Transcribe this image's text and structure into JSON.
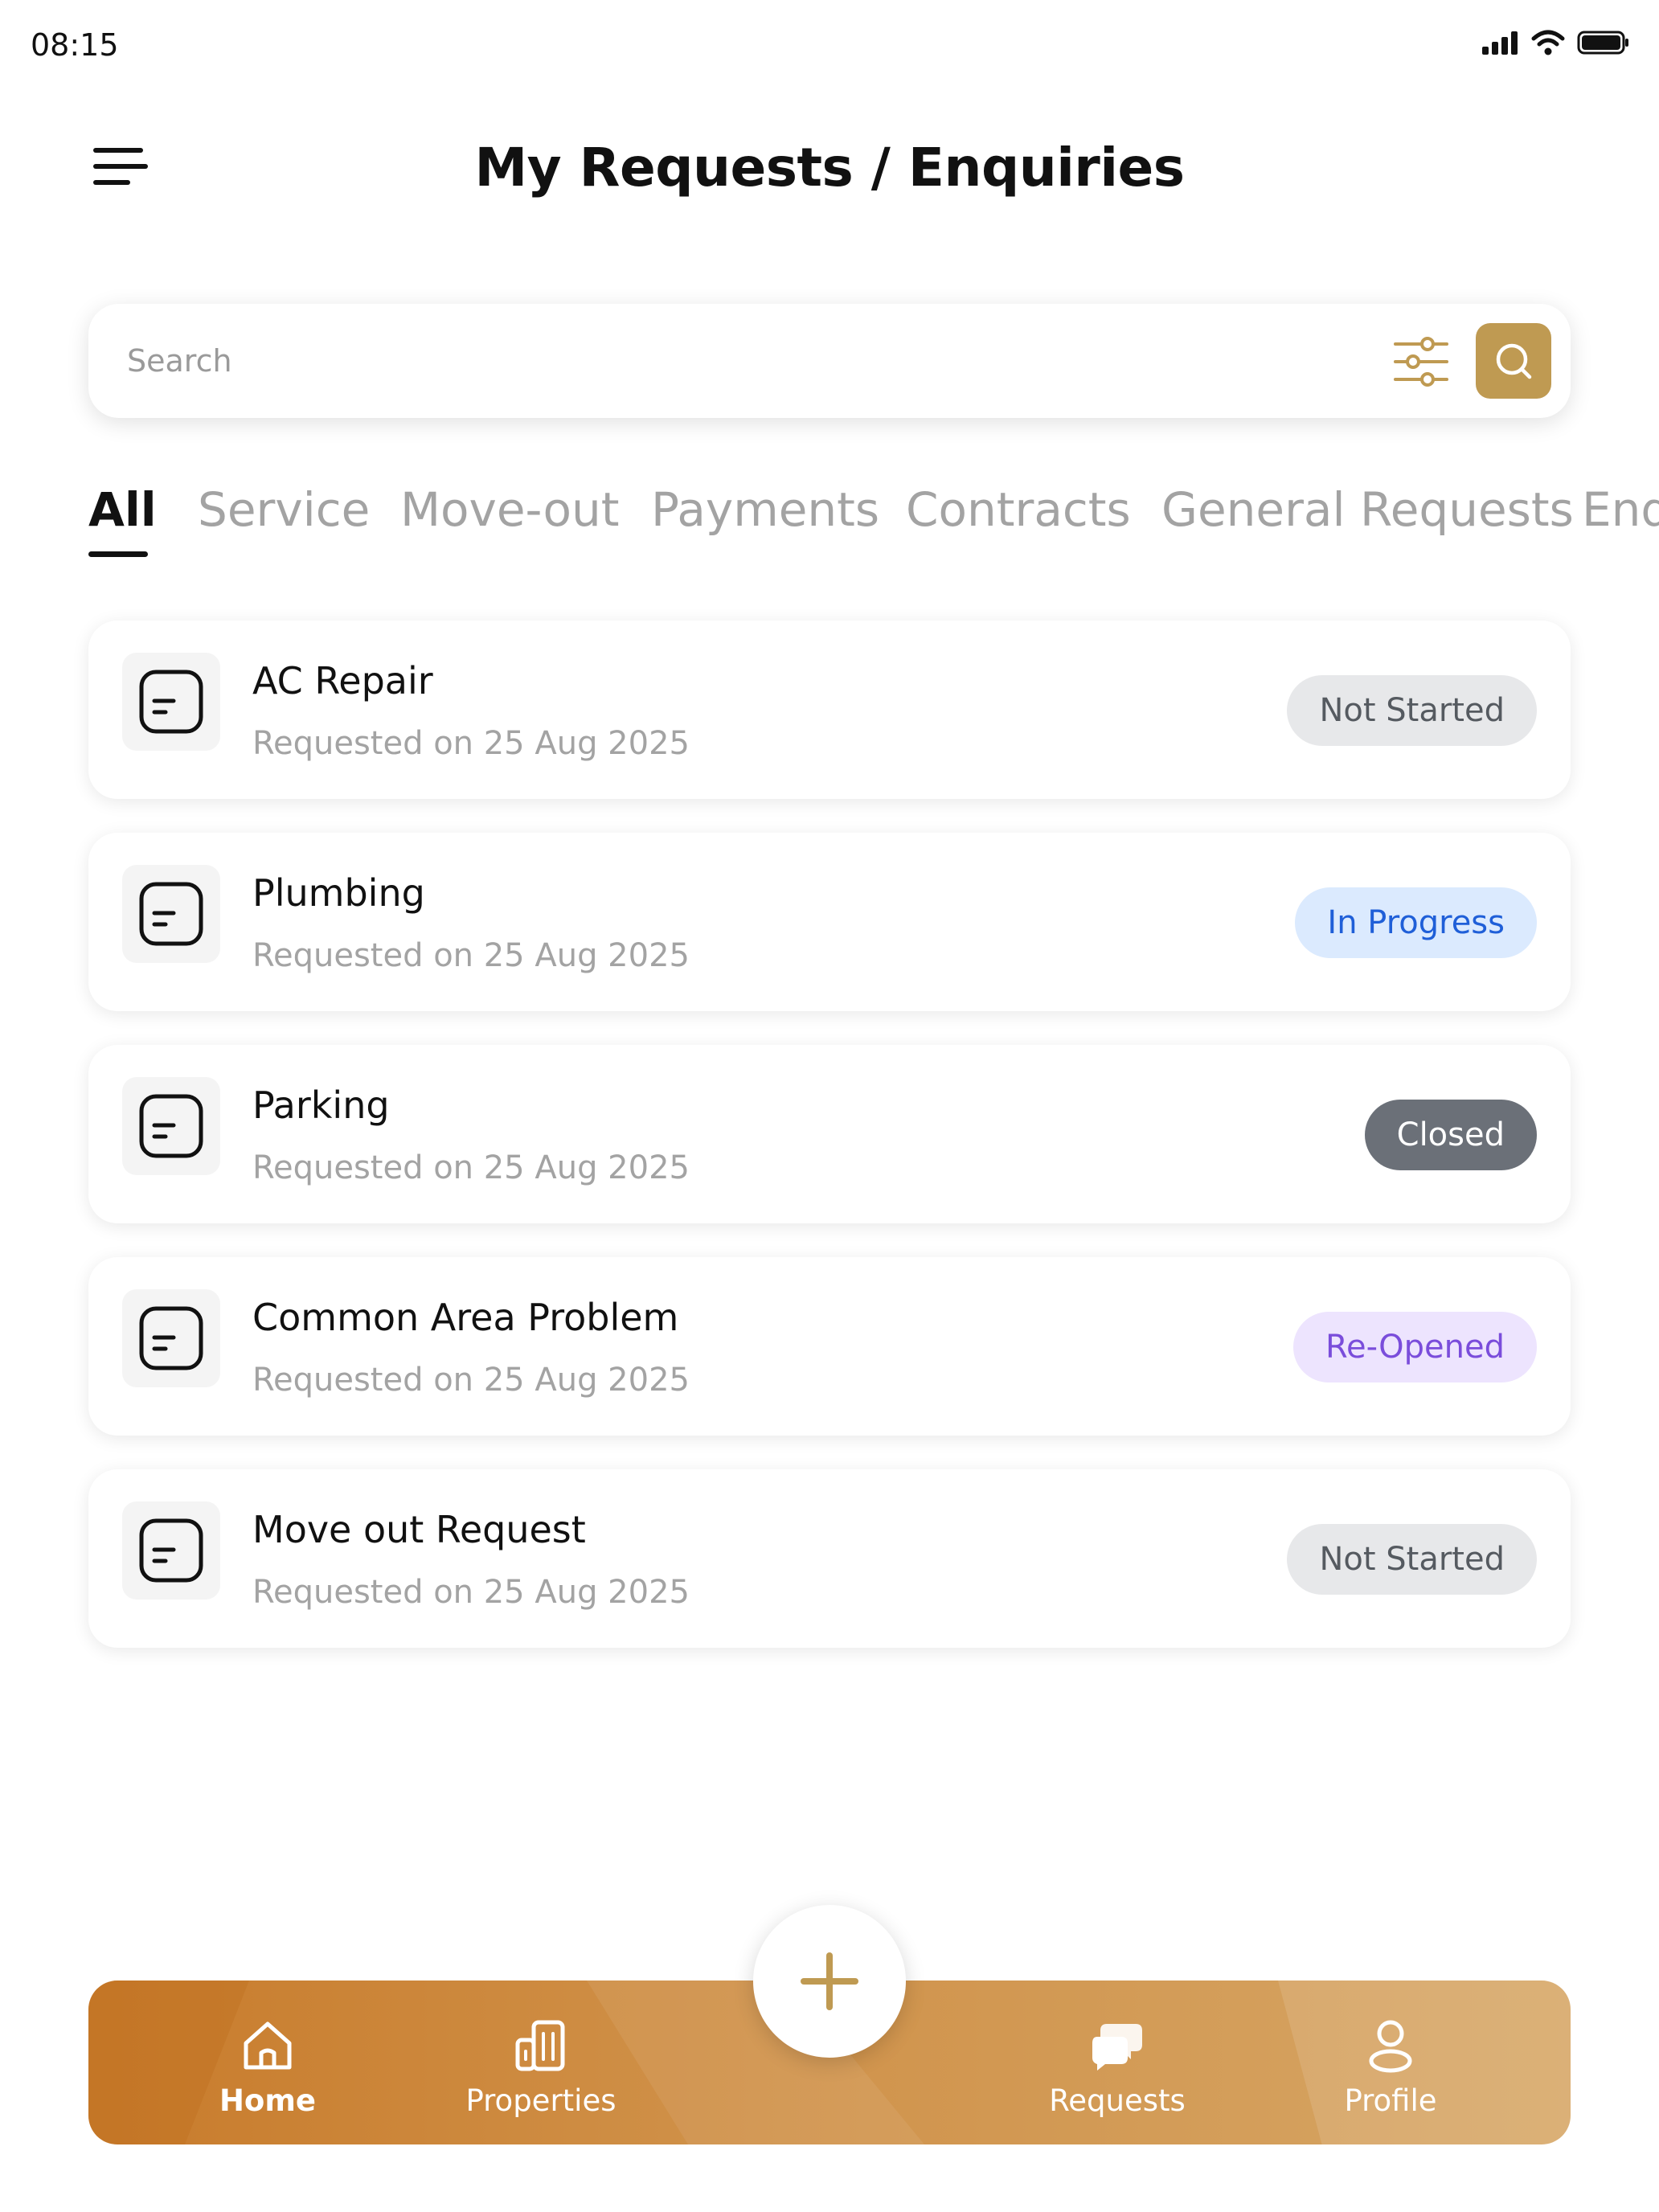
{
  "status_bar": {
    "time": "08:15"
  },
  "header": {
    "title": "My Requests / Enquiries"
  },
  "search": {
    "placeholder": "Search"
  },
  "tabs": [
    {
      "label": "All",
      "active": true
    },
    {
      "label": "Service"
    },
    {
      "label": "Move-out"
    },
    {
      "label": "Payments"
    },
    {
      "label": "Contracts"
    },
    {
      "label": "General Requests"
    },
    {
      "label": "Enquiries"
    }
  ],
  "requests": [
    {
      "title": "AC Repair",
      "date": "Requested on 25 Aug 2025",
      "status": "Not Started"
    },
    {
      "title": "Plumbing",
      "date": "Requested on 25 Aug 2025",
      "status": "In Progress"
    },
    {
      "title": "Parking",
      "date": "Requested on 25 Aug 2025",
      "status": "Closed"
    },
    {
      "title": "Common Area Problem",
      "date": "Requested on 25 Aug 2025",
      "status": "Re-Opened"
    },
    {
      "title": "Move out Request",
      "date": "Requested on 25 Aug 2025",
      "status": "Not Started"
    }
  ],
  "bottom_nav": {
    "items": [
      {
        "label": "Home",
        "icon": "home-icon",
        "active": true
      },
      {
        "label": "Properties",
        "icon": "building-icon"
      },
      {
        "label": "Requests",
        "icon": "chat-icon"
      },
      {
        "label": "Profile",
        "icon": "user-icon"
      }
    ]
  },
  "colors": {
    "accent": "#bf9a52",
    "nav_gradient_start": "#c87b2b",
    "nav_gradient_end": "#d6a665",
    "status_not_started": "#e7e8ea",
    "status_in_progress": "#dbeafe",
    "status_closed": "#6b7078",
    "status_re_opened": "#ede4fe"
  }
}
